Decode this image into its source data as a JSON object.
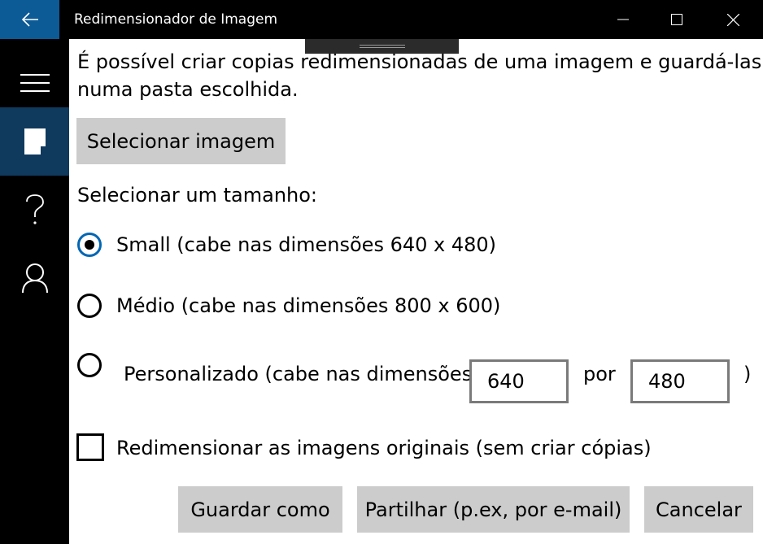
{
  "window": {
    "title": "Redimensionador de Imagem",
    "back_icon": "back-arrow-icon",
    "minimize_icon": "minimize-icon",
    "maximize_icon": "maximize-icon",
    "close_icon": "close-icon",
    "title_bar_color": "#000000",
    "back_button_color": "#0c5a96"
  },
  "nav": {
    "items": [
      {
        "icon": "hamburger-menu-icon",
        "selected": false
      },
      {
        "icon": "document-icon",
        "selected": true
      },
      {
        "icon": "help-icon",
        "selected": false
      },
      {
        "icon": "user-icon",
        "selected": false
      }
    ],
    "selected_color": "#0f3a5e"
  },
  "main": {
    "intro_line1": "É possível criar copias redimensionadas de uma imagem e guardá-las",
    "intro_line2": "numa pasta escolhida.",
    "select_image_label": "Selecionar imagem",
    "size_heading": "Selecionar um tamanho:",
    "sizes": {
      "small_label": "Small (cabe nas dimensões 640 x 480)",
      "medium_label": "Médio (cabe nas dimensões 800 x 600)",
      "custom_label": "Personalizado (cabe nas dimensões",
      "selected": "small"
    },
    "custom": {
      "width": "640",
      "by_label": "por",
      "height": "480",
      "close_paren": ")"
    },
    "resize_originals_label": "Redimensionar as imagens originais (sem criar cópias)",
    "resize_originals_checked": false,
    "buttons": {
      "save_as": "Guardar como",
      "share": "Partilhar (p.ex, por e-mail)",
      "cancel": "Cancelar"
    },
    "accent_color": "#0066b4"
  }
}
